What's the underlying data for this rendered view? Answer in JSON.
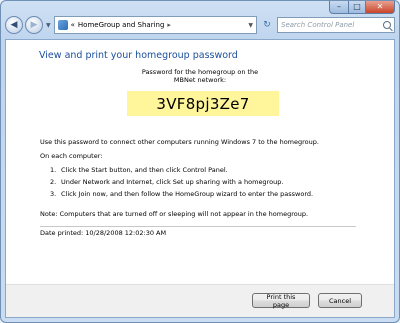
{
  "window": {
    "address": {
      "path_segment": "HomeGroup and Sharing",
      "prefix": "«",
      "separator": "▸"
    },
    "search_placeholder": "Search Control Panel"
  },
  "content": {
    "heading": "View and print your homegroup password",
    "password_caption_line1": "Password for the homegroup on the",
    "password_caption_line2": "MBNet network:",
    "password": "3VF8pj3Ze7",
    "instructions": "Use this password to connect other computers running Windows 7 to the homegroup.",
    "each_computer_label": "On each computer:",
    "steps": [
      {
        "num": "1.",
        "text": "Click the Start button, and then click Control Panel."
      },
      {
        "num": "2.",
        "text": "Under Network and Internet, click Set up sharing with a homegroup."
      },
      {
        "num": "3.",
        "text": "Click Join now, and then follow the HomeGroup wizard to enter the password."
      }
    ],
    "note": "Note: Computers that are turned off or sleeping will not appear in the homegroup.",
    "date_printed": "Date printed: 10/28/2008 12:02:30 AM"
  },
  "footer": {
    "print_label": "Print this page",
    "cancel_label": "Cancel"
  },
  "icons": {
    "back": "back-arrow-icon",
    "forward": "forward-arrow-icon",
    "refresh": "refresh-icon",
    "search": "search-icon",
    "address": "control-panel-icon"
  }
}
